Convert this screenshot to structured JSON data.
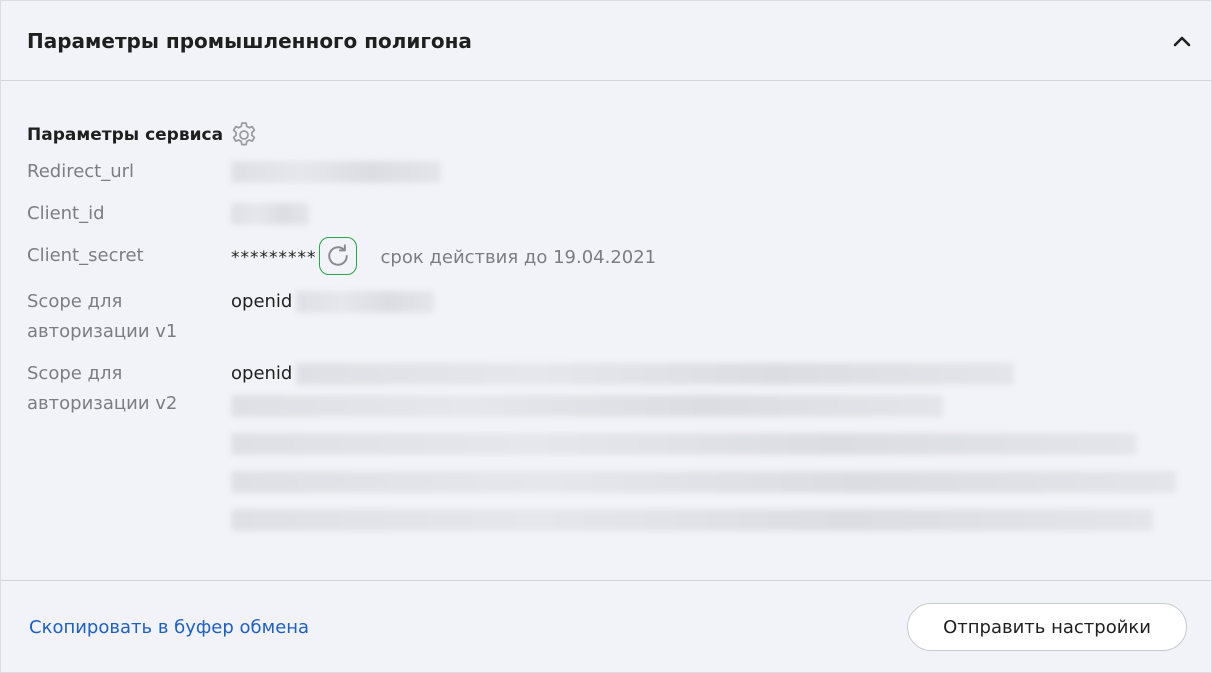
{
  "header": {
    "title": "Параметры промышленного полигона",
    "collapse_icon": "chevron-up-icon"
  },
  "service": {
    "title": "Параметры сервиса",
    "settings_icon": "gear-icon",
    "redirect_url": {
      "label": "Redirect_url"
    },
    "client_id": {
      "label": "Client_id"
    },
    "client_secret": {
      "label": "Client_secret",
      "masked_value": "*********",
      "refresh_icon": "refresh-icon",
      "expiry_text": "срок действия до 19.04.2021"
    },
    "scope_v1": {
      "label": "Scope для авторизации v1",
      "visible_value": "openid"
    },
    "scope_v2": {
      "label": "Scope для авторизации v2",
      "visible_value": "openid"
    }
  },
  "footer": {
    "copy_link": "Скопировать в буфер обмена",
    "send_button": "Отправить настройки"
  },
  "colors": {
    "accent_green": "#27a745",
    "link_blue": "#1d5fc7",
    "label_gray": "#7c7d82",
    "background": "#f2f3f8"
  }
}
